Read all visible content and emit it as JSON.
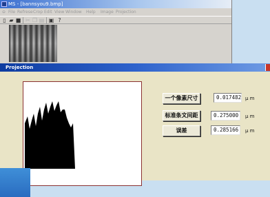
{
  "main_window": {
    "title": "MS - [bannsyou9.bmp]",
    "menu": [
      "File",
      "Refrese",
      "Crop",
      "Edit",
      "View",
      "Window",
      "Help",
      "Image",
      "Projection"
    ],
    "toolbar_icons": [
      "new-file-icon",
      "open-folder-icon",
      "save-icon",
      "cut-icon",
      "copy-icon",
      "paste-icon",
      "print-icon",
      "help-icon"
    ]
  },
  "dialog": {
    "title": "Projection",
    "rows": [
      {
        "button": "一个像素尺寸",
        "value": "0.017482",
        "unit": "μ m"
      },
      {
        "button": "标准条文间距",
        "value": "0.275000",
        "unit": "μ m"
      },
      {
        "button": "误差",
        "value": "0.285166",
        "unit": "μ m"
      }
    ]
  },
  "colors": {
    "dialog_bg": "#e9e4c6",
    "titlebar_blue": "#0d3ba0",
    "profile_fill": "#000000",
    "canvas_border": "#8a3030"
  }
}
